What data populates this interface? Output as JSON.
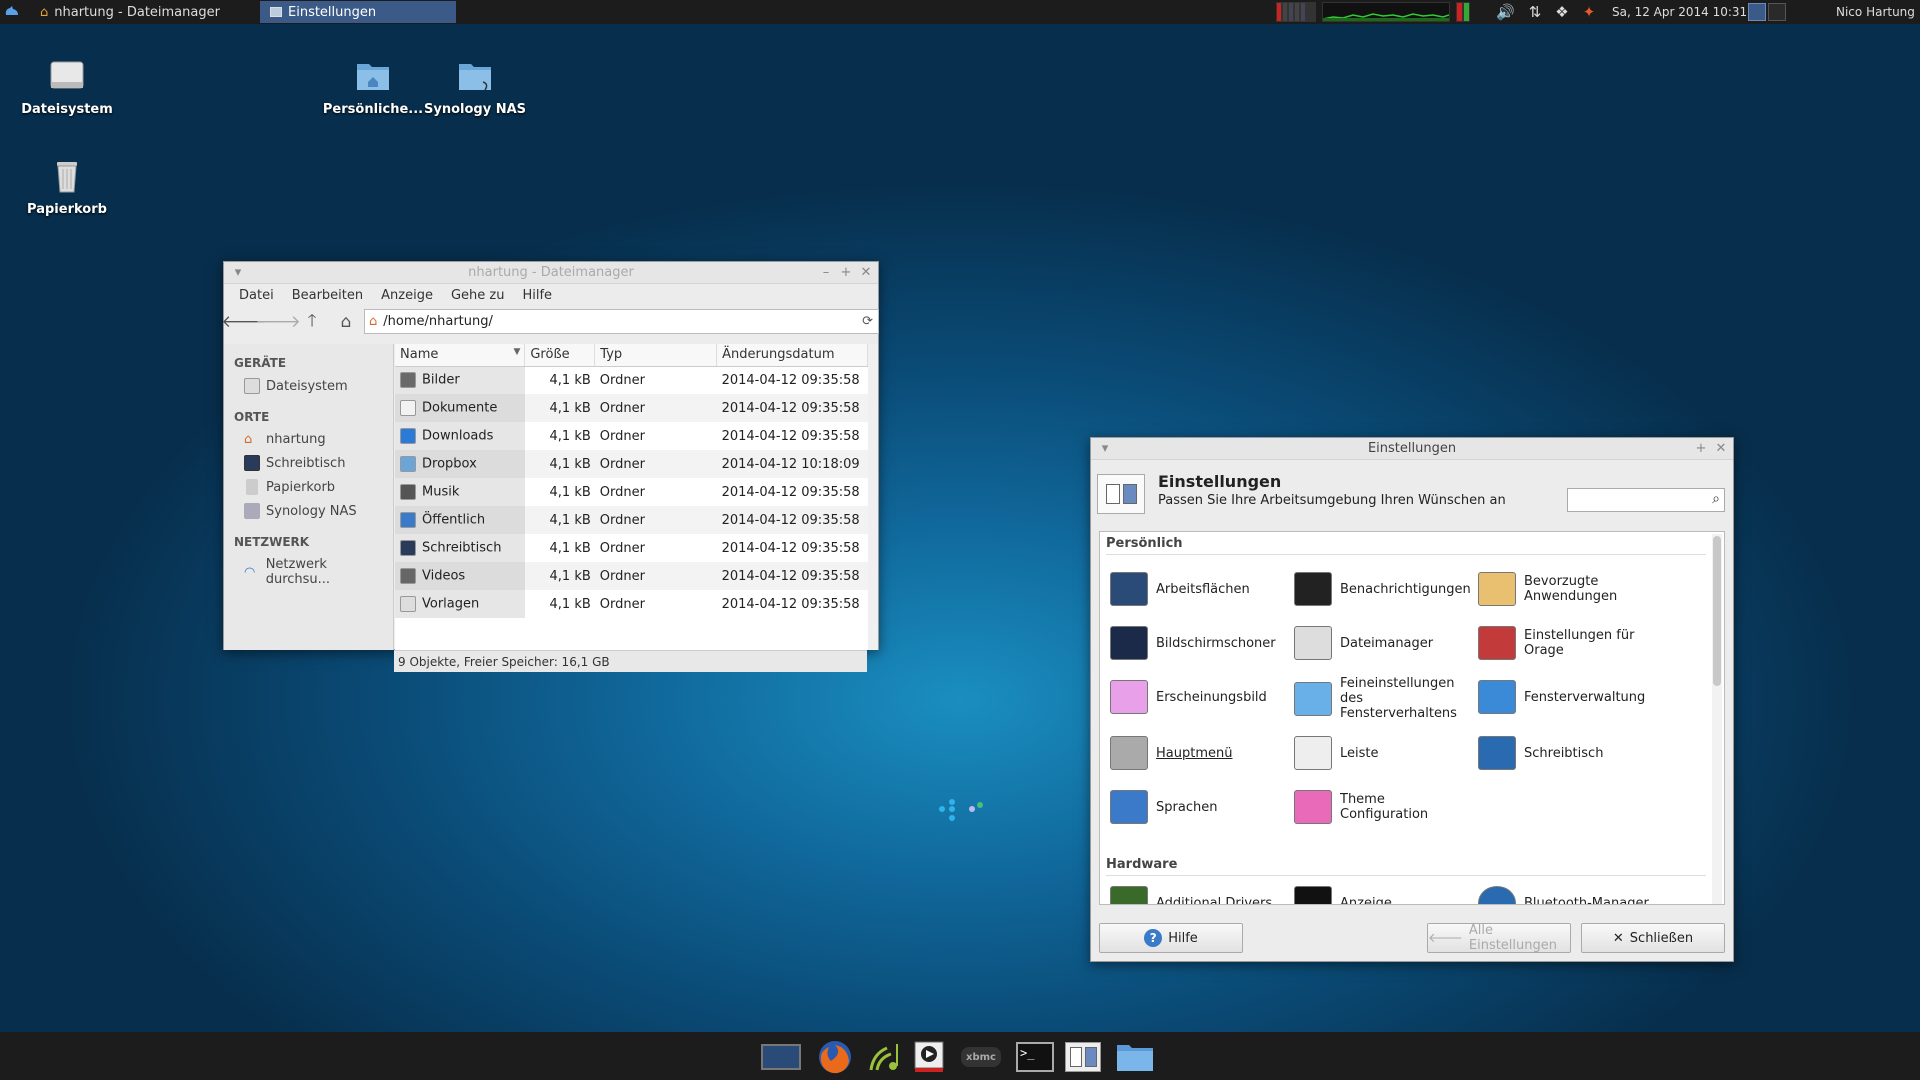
{
  "top_panel": {
    "tasks": [
      {
        "label": "nhartung - Dateimanager"
      },
      {
        "label": "Einstellungen"
      }
    ],
    "clock": "Sa, 12 Apr 2014 10:31",
    "user": "Nico Hartung"
  },
  "desktop": {
    "icons": [
      {
        "label": "Dateisystem"
      },
      {
        "label": "Papierkorb"
      },
      {
        "label": "Persönliche..."
      },
      {
        "label": "Synology NAS"
      }
    ]
  },
  "file_manager": {
    "title": "nhartung - Dateimanager",
    "menu": [
      "Datei",
      "Bearbeiten",
      "Anzeige",
      "Gehe zu",
      "Hilfe"
    ],
    "path": "/home/nhartung/",
    "sidebar": {
      "sections": [
        {
          "heading": "GERÄTE",
          "items": [
            "Dateisystem"
          ]
        },
        {
          "heading": "ORTE",
          "items": [
            "nhartung",
            "Schreibtisch",
            "Papierkorb",
            "Synology NAS"
          ]
        },
        {
          "heading": "NETZWERK",
          "items": [
            "Netzwerk durchsu..."
          ]
        }
      ]
    },
    "columns": [
      "Name",
      "Größe",
      "Typ",
      "Änderungsdatum"
    ],
    "rows": [
      {
        "name": "Bilder",
        "size": "4,1 kB",
        "type": "Ordner",
        "date": "2014-04-12 09:35:58"
      },
      {
        "name": "Dokumente",
        "size": "4,1 kB",
        "type": "Ordner",
        "date": "2014-04-12 09:35:58"
      },
      {
        "name": "Downloads",
        "size": "4,1 kB",
        "type": "Ordner",
        "date": "2014-04-12 09:35:58"
      },
      {
        "name": "Dropbox",
        "size": "4,1 kB",
        "type": "Ordner",
        "date": "2014-04-12 10:18:09"
      },
      {
        "name": "Musik",
        "size": "4,1 kB",
        "type": "Ordner",
        "date": "2014-04-12 09:35:58"
      },
      {
        "name": "Öffentlich",
        "size": "4,1 kB",
        "type": "Ordner",
        "date": "2014-04-12 09:35:58"
      },
      {
        "name": "Schreibtisch",
        "size": "4,1 kB",
        "type": "Ordner",
        "date": "2014-04-12 09:35:58"
      },
      {
        "name": "Videos",
        "size": "4,1 kB",
        "type": "Ordner",
        "date": "2014-04-12 09:35:58"
      },
      {
        "name": "Vorlagen",
        "size": "4,1 kB",
        "type": "Ordner",
        "date": "2014-04-12 09:35:58"
      }
    ],
    "status": "9 Objekte, Freier Speicher: 16,1 GB"
  },
  "settings": {
    "window_title": "Einstellungen",
    "header_title": "Einstellungen",
    "header_subtitle": "Passen Sie Ihre Arbeitsumgebung Ihren Wünschen an",
    "sections": {
      "personal": "Persönlich",
      "hardware": "Hardware"
    },
    "items": [
      "Arbeitsflächen",
      "Benachrichtigungen",
      "Bevorzugte Anwendungen",
      "Bildschirmschoner",
      "Dateimanager",
      "Einstellungen für Orage",
      "Erscheinungsbild",
      "Feineinstellungen des Fensterverhaltens",
      "Fensterverwaltung",
      "Hauptmenü",
      "Leiste",
      "Schreibtisch",
      "Sprachen",
      "Theme Configuration"
    ],
    "hardware_items": [
      "Additional Drivers",
      "Anzeige",
      "Bluetooth-Manager"
    ],
    "buttons": {
      "help": "Hilfe",
      "all": "Alle Einstellungen",
      "close": "Schließen"
    }
  },
  "colors": {
    "accent": "#3b5a88",
    "panel": "#1c1c1c",
    "folder_blue": "#6aa6d8"
  }
}
